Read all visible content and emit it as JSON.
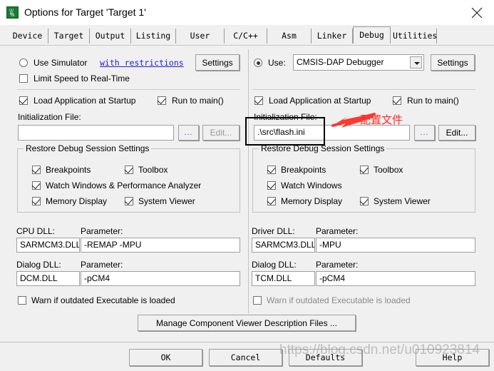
{
  "window": {
    "title": "Options for Target 'Target 1'",
    "icon": "keil-uvision-icon",
    "close_label": "✕"
  },
  "tabs": [
    {
      "label": "Device",
      "active": false
    },
    {
      "label": "Target",
      "active": false
    },
    {
      "label": "Output",
      "active": false
    },
    {
      "label": "Listing",
      "active": false
    },
    {
      "label": "User",
      "active": false
    },
    {
      "label": "C/C++",
      "active": false
    },
    {
      "label": "Asm",
      "active": false
    },
    {
      "label": "Linker",
      "active": false
    },
    {
      "label": "Debug",
      "active": true
    },
    {
      "label": "Utilities",
      "active": false
    }
  ],
  "left": {
    "use_simulator_label": "Use Simulator",
    "use_simulator_checked": false,
    "restrictions_link": "with restrictions",
    "settings_label": "Settings",
    "limit_speed_label": "Limit Speed to Real-Time",
    "limit_speed_checked": false,
    "load_app_label": "Load Application at Startup",
    "load_app_checked": true,
    "run_to_main_label": "Run to main()",
    "run_to_main_checked": true,
    "init_file_label": "Initialization File:",
    "init_file_value": "",
    "browse_label": "...",
    "edit_label": "Edit...",
    "restore_group_title": "Restore Debug Session Settings",
    "restore_items": [
      {
        "label": "Breakpoints",
        "checked": true
      },
      {
        "label": "Toolbox",
        "checked": true
      },
      {
        "label": "Watch Windows & Performance Analyzer",
        "checked": true
      },
      {
        "label": "Memory Display",
        "checked": true
      },
      {
        "label": "System Viewer",
        "checked": true
      }
    ],
    "cpu_dll_label": "CPU DLL:",
    "cpu_dll_value": "SARMCM3.DLL",
    "cpu_param_label": "Parameter:",
    "cpu_param_value": "-REMAP -MPU",
    "dialog_dll_label": "Dialog DLL:",
    "dialog_dll_value": "DCM.DLL",
    "dialog_param_label": "Parameter:",
    "dialog_param_value": "-pCM4",
    "warn_label": "Warn if outdated Executable is loaded",
    "warn_checked": false
  },
  "right": {
    "use_label": "Use:",
    "use_checked": true,
    "debugger_selected": "CMSIS-DAP Debugger",
    "settings_label": "Settings",
    "load_app_label": "Load Application at Startup",
    "load_app_checked": true,
    "run_to_main_label": "Run to main()",
    "run_to_main_checked": true,
    "init_file_label": "Initialization File:",
    "init_file_value": ".\\src\\flash.ini",
    "browse_label": "...",
    "edit_label": "Edit...",
    "restore_group_title": "Restore Debug Session Settings",
    "restore_items": [
      {
        "label": "Breakpoints",
        "checked": true
      },
      {
        "label": "Toolbox",
        "checked": true
      },
      {
        "label": "Watch Windows",
        "checked": true
      },
      {
        "label": "Memory Display",
        "checked": true
      },
      {
        "label": "System Viewer",
        "checked": true
      }
    ],
    "driver_dll_label": "Driver DLL:",
    "driver_dll_value": "SARMCM3.DLL",
    "driver_param_label": "Parameter:",
    "driver_param_value": "-MPU",
    "dialog_dll_label": "Dialog DLL:",
    "dialog_dll_value": "TCM.DLL",
    "dialog_param_label": "Parameter:",
    "dialog_param_value": "-pCM4",
    "warn_label": "Warn if outdated Executable is loaded",
    "warn_checked": false
  },
  "footer": {
    "manage_label": "Manage Component Viewer Description Files ...",
    "ok_label": "OK",
    "cancel_label": "Cancel",
    "defaults_label": "Defaults",
    "help_label": "Help"
  },
  "annotations": {
    "note_text": "配置文件",
    "note_color": "#ff2a2a",
    "watermark": "https://blog.csdn.net/u010923814"
  }
}
